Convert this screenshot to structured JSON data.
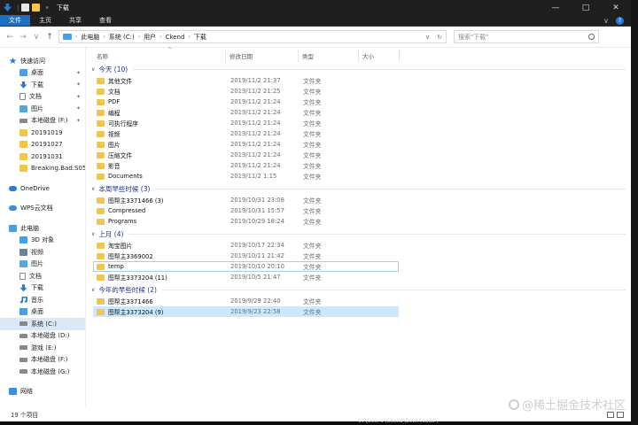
{
  "window": {
    "title": "下载",
    "minimize": "—",
    "maximize": "□",
    "close": "✕"
  },
  "ribbon": {
    "tabs": [
      "文件",
      "主页",
      "共享",
      "查看"
    ],
    "expand": "∨",
    "help": "?"
  },
  "address": {
    "crumbs": [
      "此电脑",
      "系统 (C:)",
      "用户",
      "Ckend",
      "下载"
    ],
    "refresh": "↻",
    "dropdown": "∨",
    "search_placeholder": "搜索\"下载\""
  },
  "sidebar": {
    "quick_access": "快速访问",
    "quick_items": [
      "桌面",
      "下载",
      "文档",
      "图片",
      "本地磁盘 (F:)",
      "20191019",
      "20191027",
      "20191031",
      "Breaking.Bad.S05."
    ],
    "onedrive": "OneDrive",
    "wps": "WPS云文档",
    "this_pc": "此电脑",
    "pc_items": [
      "3D 对象",
      "视频",
      "图片",
      "文档",
      "下载",
      "音乐",
      "桌面",
      "系统 (C:)",
      "本地磁盘 (D:)",
      "游戏 (E:)",
      "本地磁盘 (F:)",
      "本地磁盘 (G:)"
    ],
    "network": "网络"
  },
  "columns": {
    "name": "名称",
    "date": "修改日期",
    "type": "类型",
    "size": "大小"
  },
  "groups": [
    {
      "title": "今天 (10)",
      "rows": [
        {
          "name": "其他文件",
          "date": "2019/11/2 21:37",
          "type": "文件夹"
        },
        {
          "name": "文档",
          "date": "2019/11/2 21:25",
          "type": "文件夹"
        },
        {
          "name": "PDF",
          "date": "2019/11/2 21:24",
          "type": "文件夹"
        },
        {
          "name": "编程",
          "date": "2019/11/2 21:24",
          "type": "文件夹"
        },
        {
          "name": "可执行程序",
          "date": "2019/11/2 21:24",
          "type": "文件夹"
        },
        {
          "name": "视频",
          "date": "2019/11/2 21:24",
          "type": "文件夹"
        },
        {
          "name": "图片",
          "date": "2019/11/2 21:24",
          "type": "文件夹"
        },
        {
          "name": "压缩文件",
          "date": "2019/11/2 21:24",
          "type": "文件夹"
        },
        {
          "name": "影音",
          "date": "2019/11/2 21:24",
          "type": "文件夹"
        },
        {
          "name": "Documents",
          "date": "2019/11/2 1:15",
          "type": "文件夹"
        }
      ]
    },
    {
      "title": "本周早些时候 (3)",
      "rows": [
        {
          "name": "图帮主3371466 (3)",
          "date": "2019/10/31 23:08",
          "type": "文件夹"
        },
        {
          "name": "Compressed",
          "date": "2019/10/31 15:57",
          "type": "文件夹"
        },
        {
          "name": "Programs",
          "date": "2019/10/29 18:24",
          "type": "文件夹"
        }
      ]
    },
    {
      "title": "上月 (4)",
      "rows": [
        {
          "name": "淘宝图片",
          "date": "2019/10/17 22:34",
          "type": "文件夹"
        },
        {
          "name": "图帮主3369002",
          "date": "2019/10/11 21:42",
          "type": "文件夹"
        },
        {
          "name": "temp",
          "date": "2019/10/10 20:10",
          "type": "文件夹"
        },
        {
          "name": "图帮主3373204 (11)",
          "date": "2019/10/5 21:47",
          "type": "文件夹"
        }
      ]
    },
    {
      "title": "今年的早些时候 (2)",
      "rows": [
        {
          "name": "图帮主3371466",
          "date": "2019/9/29 22:40",
          "type": "文件夹"
        },
        {
          "name": "图帮主3373204 (9)",
          "date": "2019/9/23 22:58",
          "type": "文件夹"
        }
      ]
    }
  ],
  "status": {
    "count": "19 个项目"
  },
  "watermark": "@稀土掘金技术社区",
  "terminal_line": "C:\\Users\\Ckend\\Downloads\\"
}
